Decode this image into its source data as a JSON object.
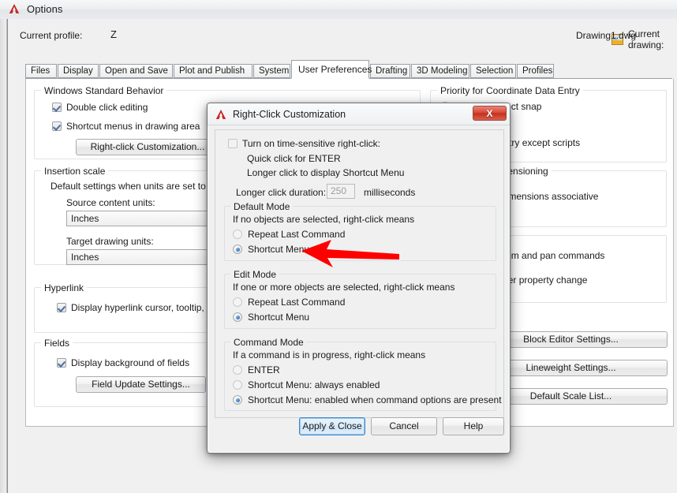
{
  "window": {
    "title": "Options",
    "logo_icon": "autocad-logo-icon"
  },
  "profile": {
    "label": "Current profile:",
    "value": "Z",
    "current_drawing_label": "Current drawing:",
    "current_drawing_icon": "drawing-file-icon",
    "current_drawing_value": "Drawing1.dwg"
  },
  "tabs": [
    {
      "label": "Files",
      "active": false
    },
    {
      "label": "Display",
      "active": false
    },
    {
      "label": "Open and Save",
      "active": false
    },
    {
      "label": "Plot and Publish",
      "active": false
    },
    {
      "label": "System",
      "active": false
    },
    {
      "label": "User Preferences",
      "active": true
    },
    {
      "label": "Drafting",
      "active": false
    },
    {
      "label": "3D Modeling",
      "active": false
    },
    {
      "label": "Selection",
      "active": false
    },
    {
      "label": "Profiles",
      "active": false
    }
  ],
  "left_panel": {
    "windows_standard_behavior": {
      "title": "Windows Standard Behavior",
      "double_click_editing": "Double click editing",
      "shortcut_menus": "Shortcut menus in drawing area",
      "right_click_customization_button": "Right-click Customization..."
    },
    "insertion_scale": {
      "title": "Insertion scale",
      "description": "Default settings when units are set to unitless:",
      "source_label": "Source content units:",
      "source_value": "Inches",
      "target_label": "Target drawing units:",
      "target_value": "Inches"
    },
    "hyperlink": {
      "title": "Hyperlink",
      "display_cursor": "Display hyperlink cursor, tooltip, and shortcut menu"
    },
    "fields": {
      "title": "Fields",
      "display_background": "Display background of fields",
      "field_update_button": "Field Update Settings..."
    }
  },
  "right_panel": {
    "priority_group_title": "Priority for Coordinate Data Entry",
    "running_object_snap": "Running object snap",
    "keyboard_entry_except_scripts": "Keyboard entry except scripts",
    "associative_dimensioning_title": "Associative Dimensioning",
    "make_new_dimensions_associative": "Make new dimensions associative",
    "undo_redo_zoom_pan": "Combine zoom and pan commands",
    "undo_redo_layer_property": "Combine layer property change",
    "block_editor_settings_button": "Block Editor Settings...",
    "lineweight_settings_button": "Lineweight Settings...",
    "default_scale_list_button": "Default Scale List..."
  },
  "modal": {
    "title": "Right-Click Customization",
    "logo_icon": "autocad-logo-icon",
    "close_icon": "close-icon",
    "close_label": "X",
    "time_sensitive": {
      "checkbox_label": "Turn on time-sensitive right-click:",
      "checked": false,
      "quick_click": "Quick click for ENTER",
      "longer_click": "Longer click to display Shortcut Menu",
      "duration_label": "Longer click duration:",
      "duration_value": "250",
      "duration_units": "milliseconds"
    },
    "default_mode": {
      "title": "Default Mode",
      "description": "If no objects are selected, right-click means",
      "options": [
        {
          "label": "Repeat Last Command",
          "selected": false
        },
        {
          "label": "Shortcut Menu",
          "selected": true
        }
      ]
    },
    "edit_mode": {
      "title": "Edit Mode",
      "description": "If one or more objects are selected, right-click means",
      "options": [
        {
          "label": "Repeat Last Command",
          "selected": false
        },
        {
          "label": "Shortcut Menu",
          "selected": true
        }
      ]
    },
    "command_mode": {
      "title": "Command Mode",
      "description": "If a command is in progress, right-click means",
      "options": [
        {
          "label": "ENTER",
          "selected": false
        },
        {
          "label": "Shortcut Menu: always enabled",
          "selected": false
        },
        {
          "label": "Shortcut Menu: enabled when command options are present",
          "selected": true
        }
      ]
    },
    "buttons": {
      "apply_close": "Apply & Close",
      "cancel": "Cancel",
      "help": "Help"
    }
  },
  "annotation": {
    "arrow_icon": "red-arrow-pointer",
    "arrow_color": "#FF0000",
    "points_at": "Shortcut Menu"
  }
}
